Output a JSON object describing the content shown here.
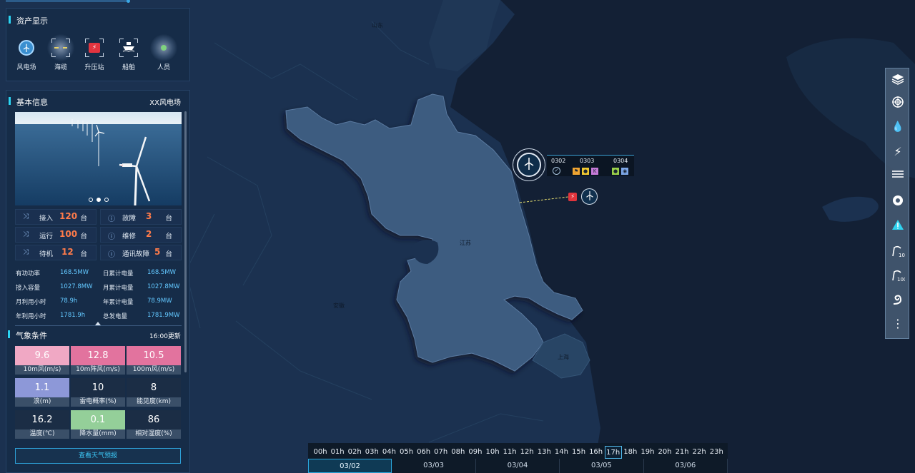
{
  "map": {
    "labels": [
      "山东",
      "江苏",
      "安徽",
      "上海"
    ]
  },
  "assets": {
    "title": "资产显示",
    "items": [
      {
        "label": "风电场",
        "icon": "wind-turbine-icon"
      },
      {
        "label": "海缆",
        "icon": "cable-icon"
      },
      {
        "label": "升压站",
        "icon": "substation-icon"
      },
      {
        "label": "船舶",
        "icon": "ship-icon"
      },
      {
        "label": "人员",
        "icon": "person-icon"
      }
    ]
  },
  "basic": {
    "title": "基本信息",
    "farm_name": "XX风电场",
    "stats": [
      {
        "label": "接入",
        "value": "120",
        "unit": "台"
      },
      {
        "label": "故障",
        "value": "3",
        "unit": "台"
      },
      {
        "label": "运行",
        "value": "100",
        "unit": "台"
      },
      {
        "label": "维修",
        "value": "2",
        "unit": "台"
      },
      {
        "label": "待机",
        "value": "12",
        "unit": "台"
      },
      {
        "label": "通讯故障",
        "value": "5",
        "unit": "台"
      }
    ],
    "info": [
      {
        "label": "有功功率",
        "value": "168.5MW"
      },
      {
        "label": "日累计电量",
        "value": "168.5MW"
      },
      {
        "label": "接入容量",
        "value": "1027.8MW"
      },
      {
        "label": "月累计电量",
        "value": "1027.8MW"
      },
      {
        "label": "月利用小时",
        "value": "78.9h"
      },
      {
        "label": "年累计电量",
        "value": "78.9MW"
      },
      {
        "label": "年利用小时",
        "value": "1781.9h"
      },
      {
        "label": "总发电量",
        "value": "1781.9MW"
      }
    ]
  },
  "weather": {
    "title": "气象条件",
    "update": "16:00更新",
    "cells": [
      {
        "value": "9.6",
        "label": "10m风(m/s)",
        "color": "#f0a8c4"
      },
      {
        "value": "12.8",
        "label": "10m阵风(m/s)",
        "color": "#e2739e"
      },
      {
        "value": "10.5",
        "label": "100m风(m/s)",
        "color": "#e2739e"
      },
      {
        "value": "1.1",
        "label": "浪(m)",
        "color": "#8d98d8"
      },
      {
        "value": "10",
        "label": "雷电概率(%)",
        "color": "#1b2d45"
      },
      {
        "value": "8",
        "label": "能见度(km)",
        "color": "#1b2d45"
      },
      {
        "value": "16.2",
        "label": "温度(℃)",
        "color": "#1b2d45"
      },
      {
        "value": "0.1",
        "label": "降水量(mm)",
        "color": "#94cf99"
      },
      {
        "value": "86",
        "label": "相对湿度(%)",
        "color": "#1b2d45"
      }
    ],
    "button": "查看天气预报"
  },
  "popup": {
    "headers": [
      "0302",
      "0303",
      "0304"
    ]
  },
  "toolbar": [
    "layers-icon",
    "radar-icon",
    "droplets-icon",
    "lightning-icon",
    "fog-icon",
    "typhoon-icon",
    "warning-icon",
    "wind-10-icon",
    "wind-100-icon",
    "wave-icon",
    "more-icon"
  ],
  "timeline": {
    "hours": [
      "00h",
      "01h",
      "02h",
      "03h",
      "04h",
      "05h",
      "06h",
      "07h",
      "08h",
      "09h",
      "10h",
      "11h",
      "12h",
      "13h",
      "14h",
      "15h",
      "16h",
      "17h",
      "18h",
      "19h",
      "20h",
      "21h",
      "22h",
      "23h"
    ],
    "active_hour": "17h",
    "dates": [
      "03/02",
      "03/03",
      "03/04",
      "03/05",
      "03/06"
    ],
    "active_date": "03/02"
  }
}
